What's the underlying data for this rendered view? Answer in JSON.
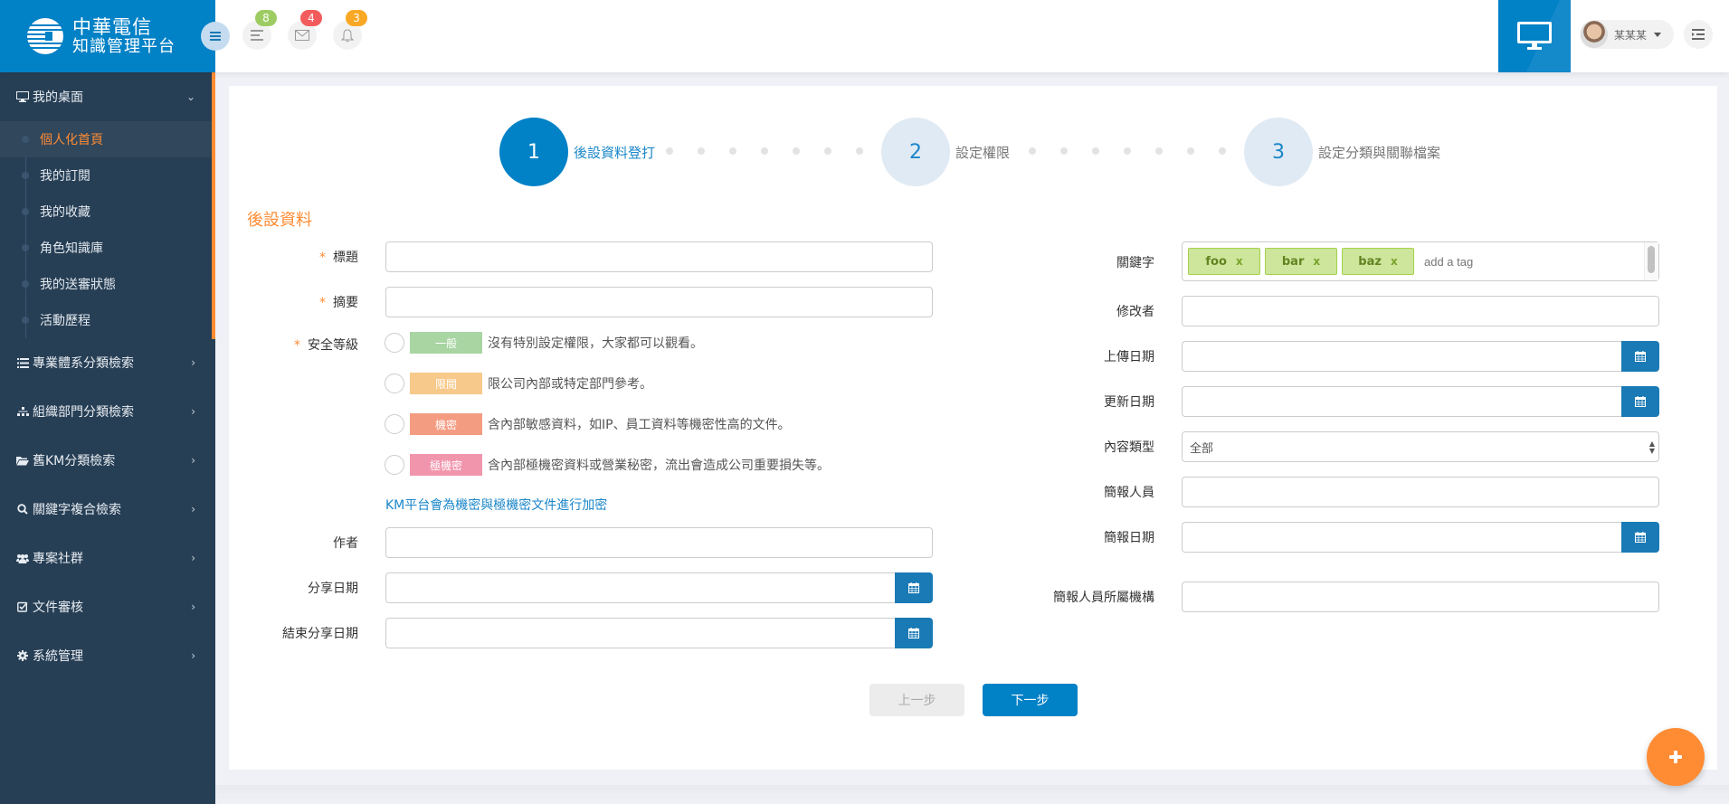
{
  "brand": {
    "line1": "中華電信",
    "line2": "知識管理平台"
  },
  "header": {
    "notifications": [
      {
        "icon": "list-icon",
        "count": "8",
        "color": "#9dcc63"
      },
      {
        "icon": "mail-icon",
        "count": "4",
        "color": "#f35c5c"
      },
      {
        "icon": "bell-icon",
        "count": "3",
        "color": "#f9a825"
      }
    ],
    "user_name": "某某某"
  },
  "sidebar": {
    "groups": [
      {
        "label": "我的桌面",
        "icon": "monitor-icon",
        "expanded": true,
        "items": [
          {
            "label": "個人化首頁",
            "active": true
          },
          {
            "label": "我的訂閱"
          },
          {
            "label": "我的收藏"
          },
          {
            "label": "角色知識庫"
          },
          {
            "label": "我的送審狀態"
          },
          {
            "label": "活動歷程"
          }
        ]
      },
      {
        "label": "專業體系分類檢索",
        "icon": "list-icon"
      },
      {
        "label": "組織部門分類檢索",
        "icon": "sitemap-icon"
      },
      {
        "label": "舊KM分類檢索",
        "icon": "folder-open-icon"
      },
      {
        "label": "關鍵字複合檢索",
        "icon": "search-icon"
      },
      {
        "label": "專案社群",
        "icon": "users-icon"
      },
      {
        "label": "文件審核",
        "icon": "check-square-icon"
      },
      {
        "label": "系統管理",
        "icon": "gear-icon"
      }
    ]
  },
  "wizard": {
    "steps": [
      {
        "number": "1",
        "label": "後設資料登打",
        "state": "current"
      },
      {
        "number": "2",
        "label": "設定權限",
        "state": "pending"
      },
      {
        "number": "3",
        "label": "設定分類與關聯檔案",
        "state": "pending"
      }
    ]
  },
  "form": {
    "section_title": "後設資料",
    "left": {
      "title": {
        "label": "標題",
        "required": true,
        "value": ""
      },
      "summary": {
        "label": "摘要",
        "required": true,
        "value": ""
      },
      "security": {
        "label": "安全等級",
        "required": true,
        "options": [
          {
            "level": "一般",
            "color": "#a8d5a2",
            "description": "沒有特別設定權限，大家都可以觀看。",
            "selected": false
          },
          {
            "level": "限閱",
            "color": "#f7c98a",
            "description": "限公司內部或特定部門參考。",
            "selected": false
          },
          {
            "level": "機密",
            "color": "#f49c82",
            "description": "含內部敏感資料，如IP、員工資料等機密性高的文件。",
            "selected": false
          },
          {
            "level": "極機密",
            "color": "#f195ad",
            "description": "含內部極機密資料或營業秘密，流出會造成公司重要損失等。",
            "selected": false
          }
        ],
        "encrypt_note": "KM平台會為機密與極機密文件進行加密"
      },
      "author": {
        "label": "作者",
        "value": ""
      },
      "share_date": {
        "label": "分享日期",
        "value": ""
      },
      "end_share_date": {
        "label": "結束分享日期",
        "value": ""
      }
    },
    "right": {
      "keywords": {
        "label": "關鍵字",
        "tags": [
          "foo",
          "bar",
          "baz"
        ],
        "remove_glyph": "x",
        "placeholder": "add a tag"
      },
      "modifier": {
        "label": "修改者",
        "value": ""
      },
      "upload_date": {
        "label": "上傳日期",
        "value": ""
      },
      "update_date": {
        "label": "更新日期",
        "value": ""
      },
      "content_type": {
        "label": "內容類型",
        "selected": "全部"
      },
      "presenter": {
        "label": "簡報人員",
        "value": ""
      },
      "presentation_date": {
        "label": "簡報日期",
        "value": ""
      },
      "presenter_org": {
        "label": "簡報人員所屬機構",
        "value": ""
      }
    }
  },
  "buttons": {
    "prev": "上一步",
    "next": "下一步"
  },
  "required_mark": "*"
}
